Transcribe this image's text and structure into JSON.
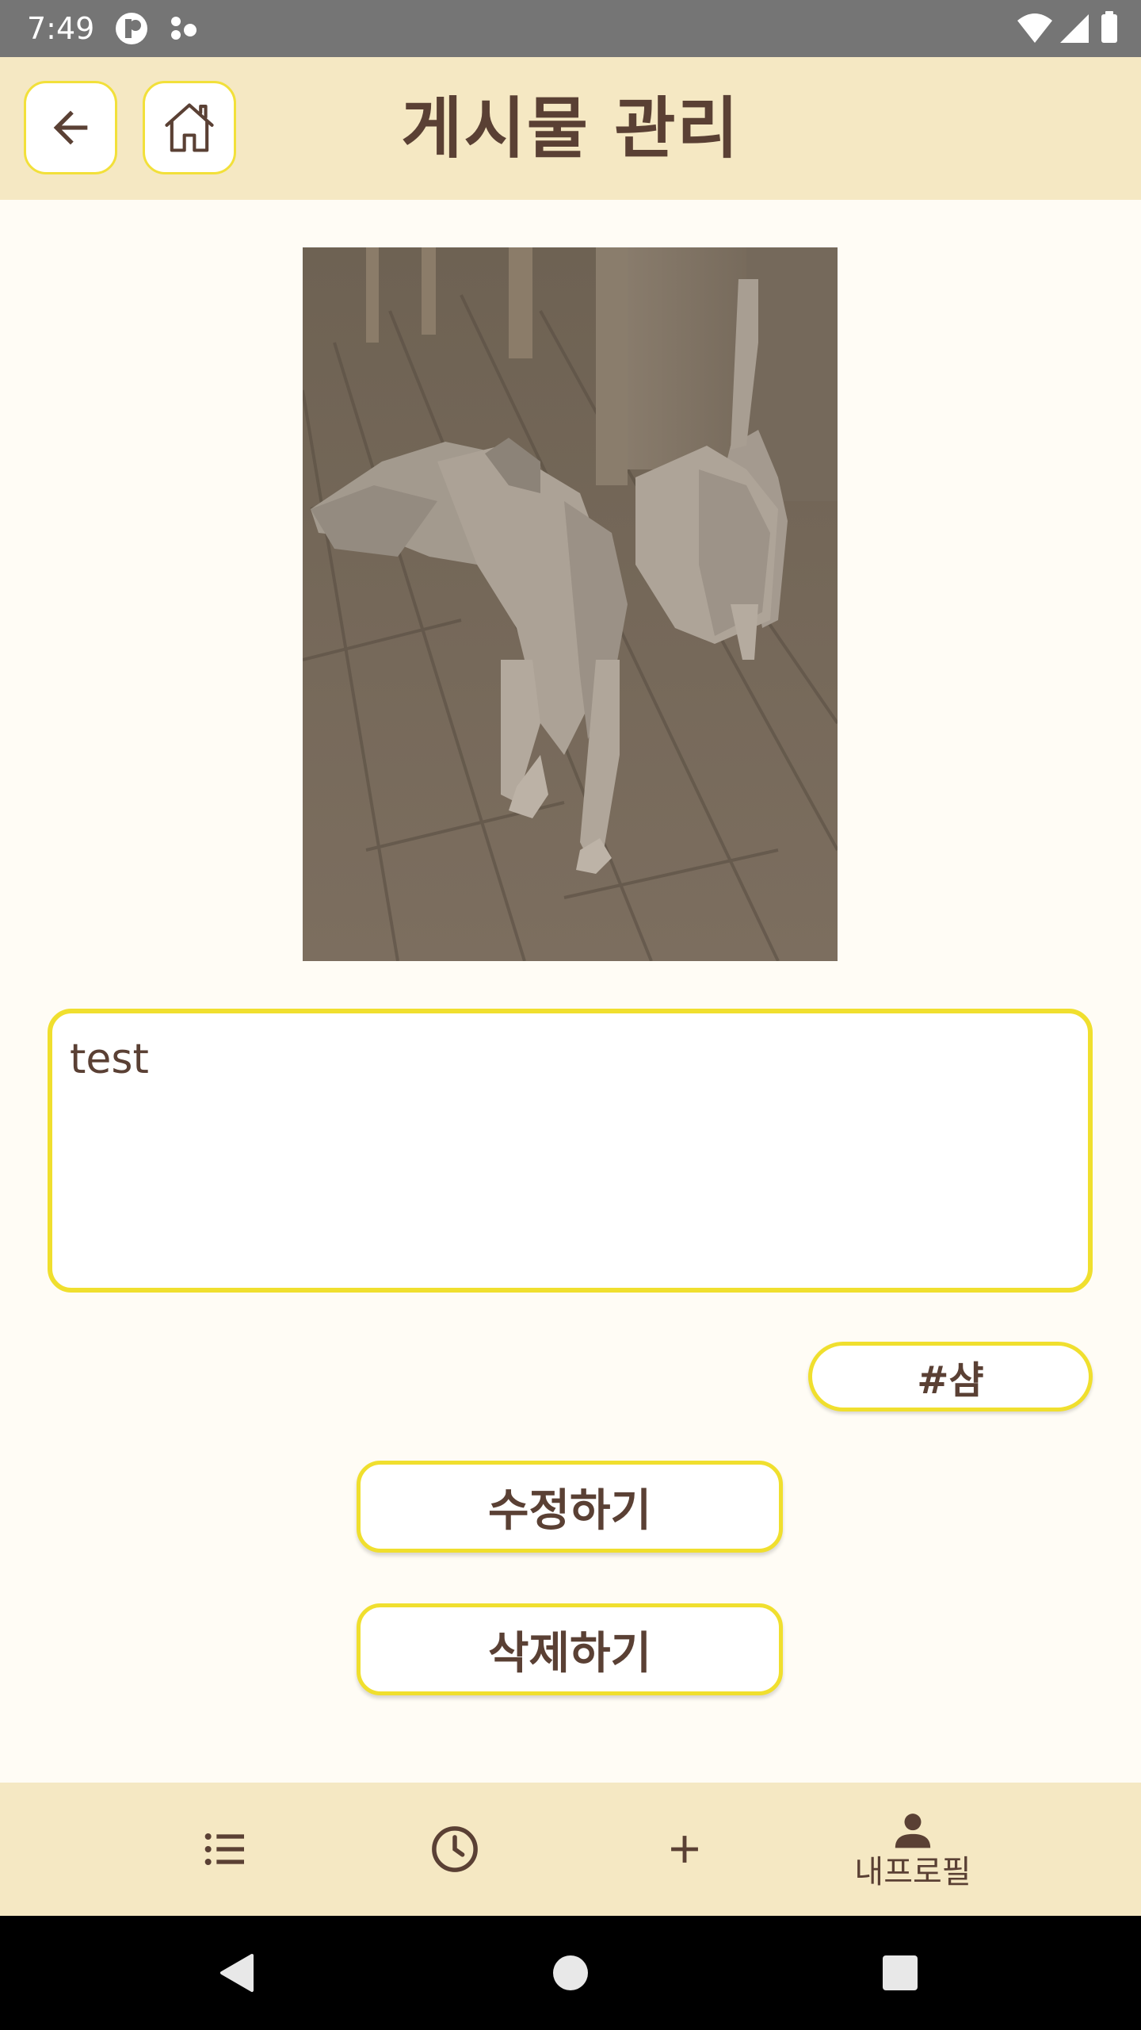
{
  "status_bar": {
    "time": "7:49",
    "icons": [
      "app-notification-icon",
      "assistant-dots-icon",
      "wifi-icon",
      "cell-signal-icon",
      "battery-icon"
    ]
  },
  "header": {
    "title": "게시물 관리",
    "back_icon": "arrow-left-icon",
    "home_icon": "home-icon"
  },
  "post": {
    "photo": "low-poly-dog-on-wooden-floor",
    "content_text": "test",
    "tag": "#샴"
  },
  "actions": {
    "edit_label": "수정하기",
    "delete_label": "삭제하기"
  },
  "bottom_nav": {
    "items": [
      {
        "icon": "list-icon",
        "label": ""
      },
      {
        "icon": "clock-icon",
        "label": ""
      },
      {
        "icon": "plus-icon",
        "label": ""
      },
      {
        "icon": "person-icon",
        "label": "내프로필"
      }
    ]
  },
  "colors": {
    "header_bg": "#f5e8c3",
    "accent_border": "#f0df2e",
    "text_brown": "#5a4034",
    "page_bg": "#fffcf5",
    "status_bar_bg": "#757575",
    "system_nav_bg": "#000000"
  }
}
